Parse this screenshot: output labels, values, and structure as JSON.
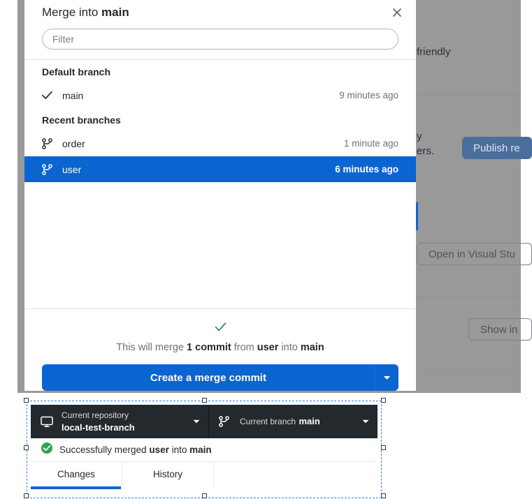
{
  "background": {
    "text_friendly": "friendly",
    "text_description": "y\ners.",
    "publish_button": "Publish re",
    "open_vs_button": "Open in Visual Stu",
    "show_in_button": "Show in"
  },
  "dialog": {
    "title_prefix": "Merge into ",
    "title_branch": "main",
    "close_icon": "close-icon",
    "filter": {
      "placeholder": "Filter",
      "value": ""
    },
    "groups": [
      {
        "header": "Default branch",
        "branches": [
          {
            "name": "main",
            "time": "9 minutes ago",
            "icon": "check-icon",
            "selected": false
          }
        ]
      },
      {
        "header": "Recent branches",
        "branches": [
          {
            "name": "order",
            "time": "1 minute ago",
            "icon": "git-branch-icon",
            "selected": false
          },
          {
            "name": "user",
            "time": "6 minutes ago",
            "icon": "git-branch-icon",
            "selected": true
          }
        ]
      }
    ],
    "footer": {
      "status_icon": "check-icon",
      "message_part_1": "This will merge ",
      "message_commits": "1 commit",
      "message_part_2": " from ",
      "message_source": "user",
      "message_part_3": " into ",
      "message_target": "main",
      "merge_button": "Create a merge commit",
      "merge_caret_icon": "chevron-down-icon"
    }
  },
  "app_panel": {
    "repository": {
      "icon": "repository-icon",
      "label": "Current repository",
      "value": "local-test-branch",
      "caret_icon": "chevron-down-icon"
    },
    "branch": {
      "icon": "git-branch-icon",
      "label": "Current branch",
      "value": "main",
      "caret_icon": "chevron-down-icon"
    },
    "banner": {
      "icon": "success-check-icon",
      "text_part_1": "Successfully merged ",
      "text_source": "user",
      "text_part_2": " into ",
      "text_target": "main"
    },
    "tabs": [
      {
        "label": "Changes",
        "active": true
      },
      {
        "label": "History",
        "active": false
      }
    ]
  },
  "colors": {
    "accent_blue": "#0b65d0",
    "dark_toolbar": "#24292e",
    "success_green": "#2ea44f",
    "check_green": "#22863a",
    "selection_blue": "#2f80ed"
  }
}
